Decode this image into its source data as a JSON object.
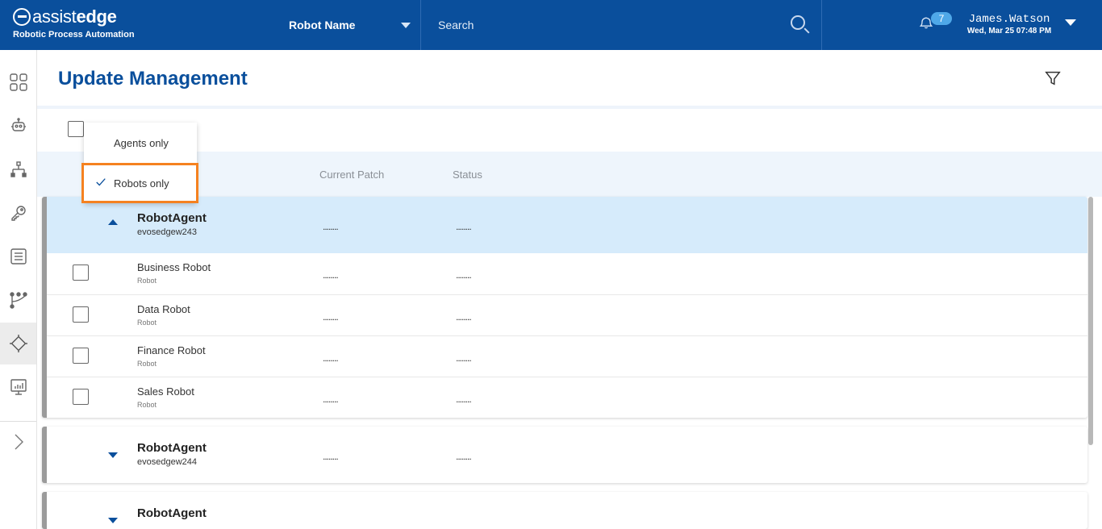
{
  "header": {
    "logo_assist": "assist",
    "logo_edge": "edge",
    "logo_sub": "Robotic Process Automation",
    "robot_select_label": "Robot Name",
    "search_placeholder": "Search",
    "notification_count": "7",
    "user_name": "James.Watson",
    "user_datetime": "Wed, Mar 25 07:48 PM"
  },
  "sidebar": {
    "items": [
      "dashboard-icon",
      "robot-icon",
      "hierarchy-icon",
      "key-icon",
      "list-icon",
      "workflow-icon",
      "chip-icon",
      "monitor-chart-icon"
    ],
    "active_index": 6,
    "expand_icon": "chevron-right-icon"
  },
  "page": {
    "title": "Update Management"
  },
  "dropdown": {
    "options": [
      {
        "label": "Agents only",
        "selected": false
      },
      {
        "label": "Robots only",
        "selected": true
      }
    ]
  },
  "columns": {
    "current_patch": "Current Patch",
    "status": "Status"
  },
  "groups": [
    {
      "name": "RobotAgent",
      "host": "evosedgew243",
      "patch": "........",
      "status": "........",
      "expanded": true,
      "rows": [
        {
          "name": "Business Robot",
          "type": "Robot",
          "patch": "........",
          "status": "........"
        },
        {
          "name": "Data Robot",
          "type": "Robot",
          "patch": "........",
          "status": "........"
        },
        {
          "name": "Finance Robot",
          "type": "Robot",
          "patch": "........",
          "status": "........"
        },
        {
          "name": "Sales Robot",
          "type": "Robot",
          "patch": "........",
          "status": "........"
        }
      ]
    },
    {
      "name": "RobotAgent",
      "host": "evosedgew244",
      "patch": "........",
      "status": "........",
      "expanded": false,
      "rows": []
    },
    {
      "name": "RobotAgent",
      "host": "",
      "patch": "",
      "status": "",
      "expanded": false,
      "rows": []
    }
  ],
  "colors": {
    "brand_blue": "#0a4f9c",
    "highlight_orange": "#f58220",
    "expanded_row_bg": "#d6ebfb"
  }
}
